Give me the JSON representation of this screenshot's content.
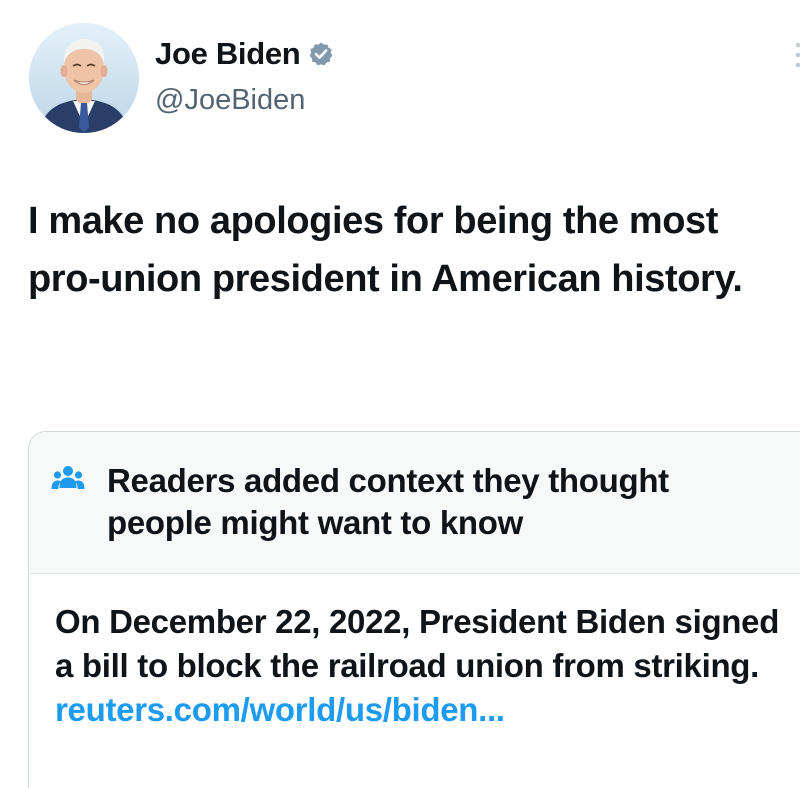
{
  "author": {
    "display_name": "Joe Biden",
    "handle": "@JoeBiden",
    "verified_icon": "verified-badge-icon",
    "avatar": "profile-photo"
  },
  "tweet": {
    "text": "I make no apologies for being the most pro-union president in American history."
  },
  "community_note": {
    "icon": "people-icon",
    "header": "Readers added context they thought people might want to know",
    "body": "On December 22, 2022, President Biden signed a bill to block the railroad union from striking.",
    "link_text": "reuters.com/world/us/biden..."
  },
  "colors": {
    "text": "#0f1419",
    "secondary_text": "#536471",
    "link": "#1d9bf0",
    "verified_badge": "#829aab",
    "note_header_bg": "#f7f9f9",
    "border": "#cfd9de"
  }
}
